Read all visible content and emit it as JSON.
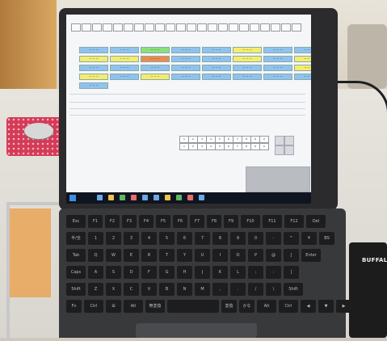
{
  "scene": {
    "drive_brand": "BUFFALO",
    "app": {
      "window_title": "",
      "tag_rows": [
        [
          {
            "label": "ー ー ー",
            "color": "#8fc3ef"
          },
          {
            "label": "ー ー ー",
            "color": "#8fc3ef"
          },
          {
            "label": "ー ー ー",
            "color": "#8be07a"
          },
          {
            "label": "ー ー ー",
            "color": "#8fc3ef"
          },
          {
            "label": "ー ー ー",
            "color": "#8fc3ef"
          },
          {
            "label": "ー ー ー",
            "color": "#f4ec6e"
          },
          {
            "label": "ー ー ー",
            "color": "#8fc3ef"
          },
          {
            "label": "ー ー ー",
            "color": "#8fc3ef"
          }
        ],
        [
          {
            "label": "ー ー ー",
            "color": "#f4ec6e"
          },
          {
            "label": "ー ー ー",
            "color": "#f4ec6e"
          },
          {
            "label": "ー ー ー",
            "color": "#f08a4b"
          },
          {
            "label": "ー ー ー",
            "color": "#8fc3ef"
          },
          {
            "label": "ー ー ー",
            "color": "#8fc3ef"
          },
          {
            "label": "ー ー ー",
            "color": "#f4ec6e"
          },
          {
            "label": "ー ー ー",
            "color": "#8fc3ef"
          },
          {
            "label": "ー ー ー",
            "color": "#f4ec6e"
          }
        ],
        [
          {
            "label": "ー ー ー",
            "color": "#8fc3ef"
          },
          {
            "label": "ー ー ー",
            "color": "#8fc3ef"
          },
          {
            "label": "ー ー ー",
            "color": "#8fc3ef"
          },
          {
            "label": "ー ー ー",
            "color": "#8fc3ef"
          },
          {
            "label": "ー ー ー",
            "color": "#8fc3ef"
          },
          {
            "label": "ー ー ー",
            "color": "#8fc3ef"
          },
          {
            "label": "ー ー ー",
            "color": "#8fc3ef"
          },
          {
            "label": "ー ー ー",
            "color": "#f4ec6e"
          }
        ],
        [
          {
            "label": "ー ー ー",
            "color": "#f4ec6e"
          },
          {
            "label": "ー ー ー",
            "color": "#8fc3ef"
          },
          {
            "label": "ー ー ー",
            "color": "#f4ec6e"
          },
          {
            "label": "ー ー ー",
            "color": "#8fc3ef"
          },
          {
            "label": "ー ー ー",
            "color": "#8fc3ef"
          },
          {
            "label": "ー ー ー",
            "color": "#8fc3ef"
          },
          {
            "label": "ー ー ー",
            "color": "#8fc3ef"
          },
          {
            "label": "ー ー ー",
            "color": "#8fc3ef"
          }
        ],
        [
          {
            "label": "ー ー ー",
            "color": "#8fc3ef"
          }
        ]
      ],
      "keypad_digits": [
        "1",
        "2",
        "3",
        "4",
        "5",
        "6",
        "7",
        "8",
        "9",
        "0",
        "1",
        "2",
        "3",
        "4",
        "5",
        "6",
        "7",
        "8",
        "9",
        "0"
      ]
    },
    "keyboard": {
      "rows": [
        [
          "Esc",
          "F1",
          "F2",
          "F3",
          "F4",
          "F5",
          "F6",
          "F7",
          "F8",
          "F9",
          "F10",
          "F11",
          "F12",
          "Del"
        ],
        [
          "半/全",
          "1",
          "2",
          "3",
          "4",
          "5",
          "6",
          "7",
          "8",
          "9",
          "0",
          "-",
          "^",
          "¥",
          "BS"
        ],
        [
          "Tab",
          "Q",
          "W",
          "E",
          "R",
          "T",
          "Y",
          "U",
          "I",
          "O",
          "P",
          "@",
          "[",
          "Enter"
        ],
        [
          "Caps",
          "A",
          "S",
          "D",
          "F",
          "G",
          "H",
          "J",
          "K",
          "L",
          ";",
          ":",
          "]"
        ],
        [
          "Shift",
          "Z",
          "X",
          "C",
          "V",
          "B",
          "N",
          "M",
          ",",
          ".",
          "/",
          "\\",
          "Shift"
        ],
        [
          "Fn",
          "Ctrl",
          "⊞",
          "Alt",
          "無変換",
          "",
          "変換",
          "かな",
          "Alt",
          "Ctrl",
          "◀",
          "▼",
          "▶"
        ]
      ]
    }
  }
}
